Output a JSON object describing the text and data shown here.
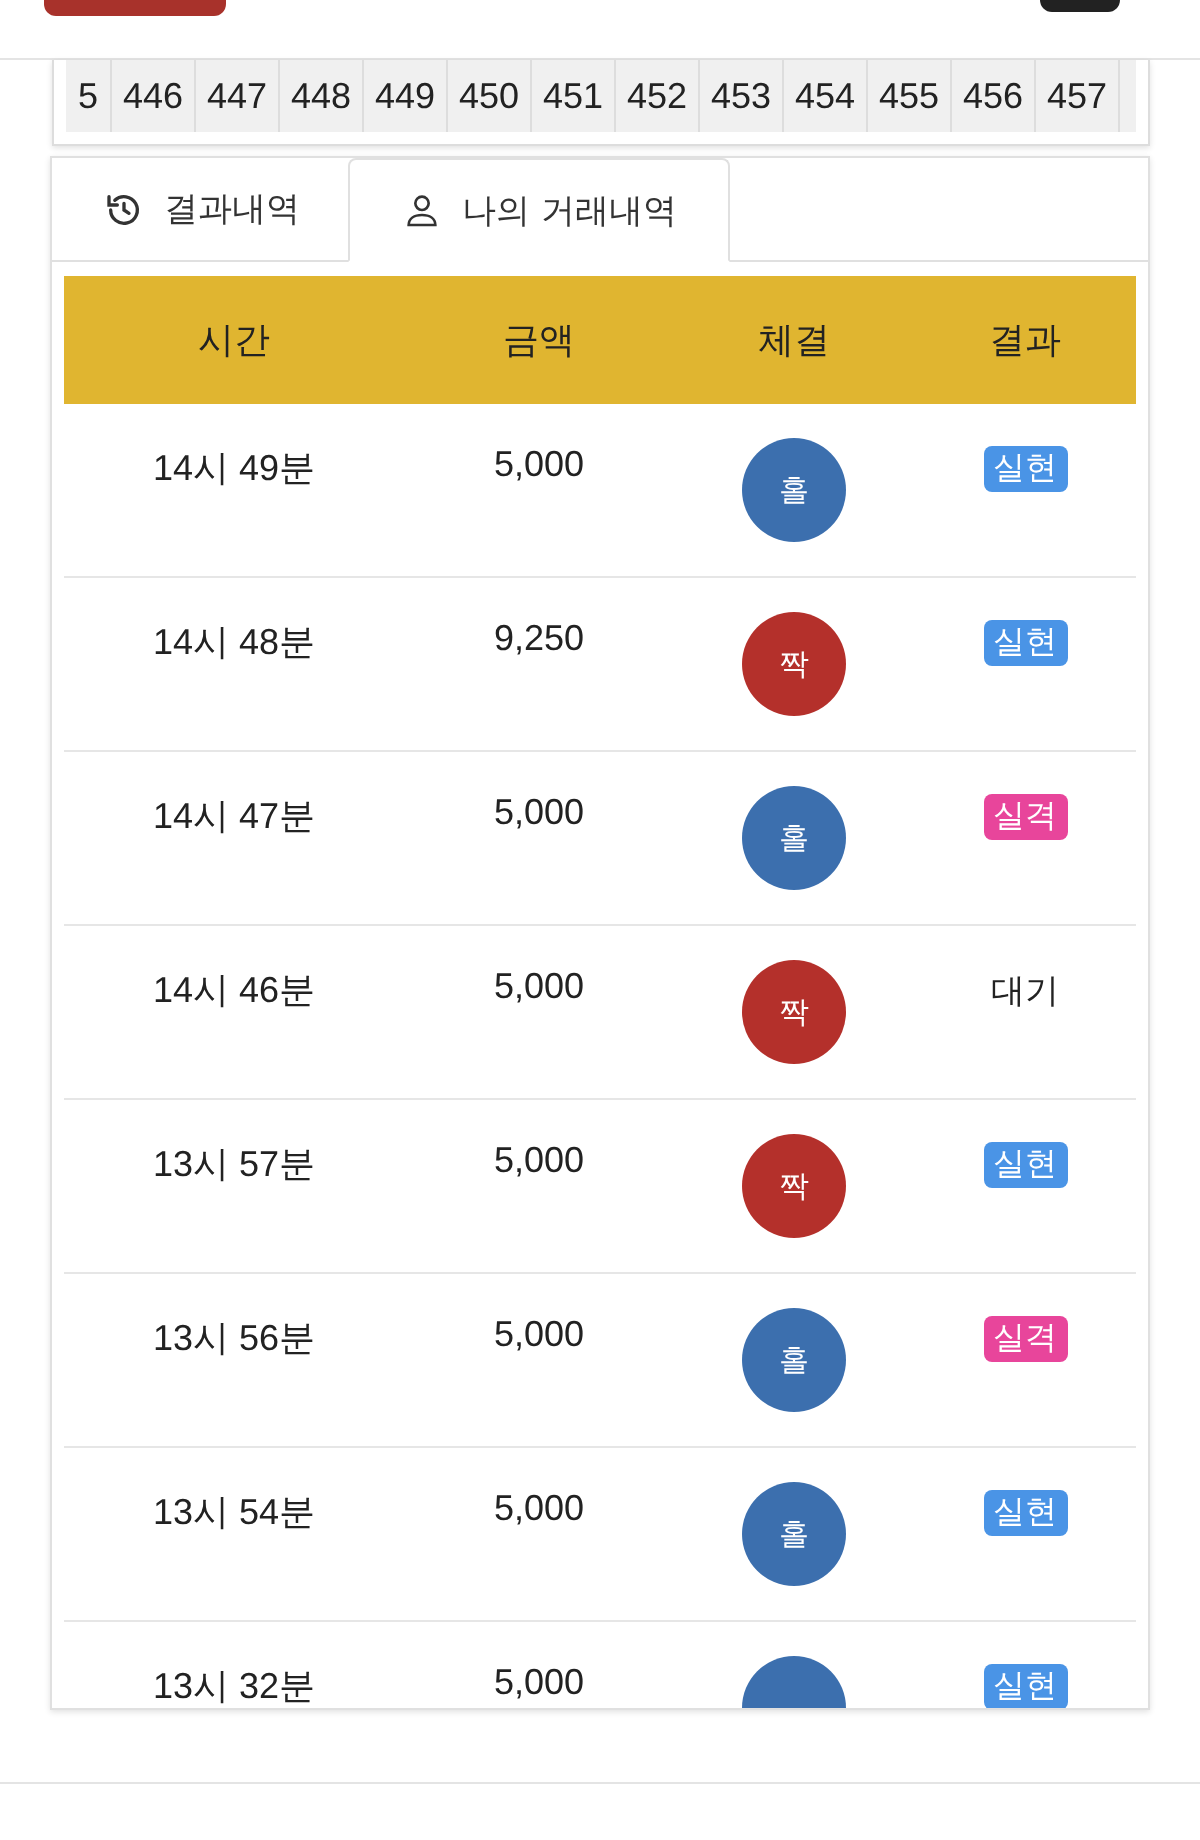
{
  "rounds": [
    "5",
    "446",
    "447",
    "448",
    "449",
    "450",
    "451",
    "452",
    "453",
    "454",
    "455",
    "456",
    "457"
  ],
  "tabs": [
    {
      "label": "결과내역",
      "kind": "history",
      "selected": false
    },
    {
      "label": "나의 거래내역",
      "kind": "user",
      "selected": true
    }
  ],
  "table": {
    "columns": [
      "시간",
      "금액",
      "체결",
      "결과"
    ],
    "rows": [
      {
        "time": "14시 49분",
        "amount": "5,000",
        "bet": {
          "label": "홀",
          "kind": "odd"
        },
        "result": {
          "label": "실현",
          "kind": "win"
        }
      },
      {
        "time": "14시 48분",
        "amount": "9,250",
        "bet": {
          "label": "짝",
          "kind": "even"
        },
        "result": {
          "label": "실현",
          "kind": "win"
        }
      },
      {
        "time": "14시 47분",
        "amount": "5,000",
        "bet": {
          "label": "홀",
          "kind": "odd"
        },
        "result": {
          "label": "실격",
          "kind": "lose"
        }
      },
      {
        "time": "14시 46분",
        "amount": "5,000",
        "bet": {
          "label": "짝",
          "kind": "even"
        },
        "result": {
          "label": "대기",
          "kind": "pending"
        }
      },
      {
        "time": "13시 57분",
        "amount": "5,000",
        "bet": {
          "label": "짝",
          "kind": "even"
        },
        "result": {
          "label": "실현",
          "kind": "win"
        }
      },
      {
        "time": "13시 56분",
        "amount": "5,000",
        "bet": {
          "label": "홀",
          "kind": "odd"
        },
        "result": {
          "label": "실격",
          "kind": "lose"
        }
      },
      {
        "time": "13시 54분",
        "amount": "5,000",
        "bet": {
          "label": "홀",
          "kind": "odd"
        },
        "result": {
          "label": "실현",
          "kind": "win"
        }
      },
      {
        "time": "13시 32분",
        "amount": "5,000",
        "bet": {
          "kind": "odd"
        },
        "result": {
          "label": "실현",
          "kind": "win"
        }
      }
    ]
  }
}
